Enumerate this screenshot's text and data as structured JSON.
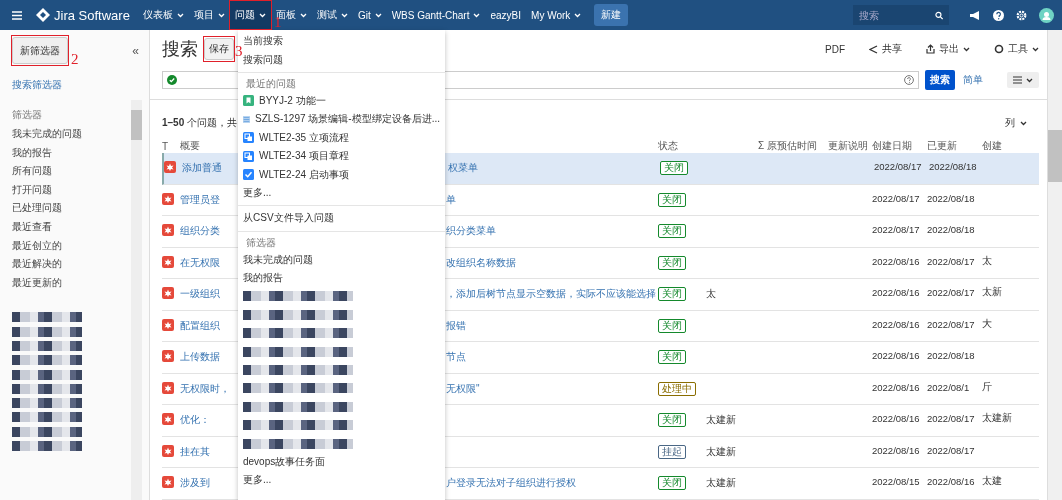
{
  "top_nav": {
    "product": "Jira Software",
    "items": [
      {
        "label": "仪表板",
        "dropdown": true,
        "selected": false
      },
      {
        "label": "项目",
        "dropdown": true,
        "selected": false
      },
      {
        "label": "问题",
        "dropdown": true,
        "selected": true
      },
      {
        "label": "面板",
        "dropdown": true,
        "selected": false
      },
      {
        "label": "测试",
        "dropdown": true,
        "selected": false
      },
      {
        "label": "Git",
        "dropdown": true,
        "selected": false
      },
      {
        "label": "WBS Gantt-Chart",
        "dropdown": true,
        "selected": false
      },
      {
        "label": "eazyBI",
        "dropdown": false,
        "selected": false
      },
      {
        "label": "My Work",
        "dropdown": true,
        "selected": false
      }
    ],
    "create_button": "新建",
    "search": {
      "placeholder": "搜索"
    }
  },
  "sidebar": {
    "new_filter_button": "新筛选器",
    "collapse": "«",
    "search_filters_link": "搜索筛选器",
    "sections": [
      {
        "heading": "筛选器",
        "items": [
          {
            "kind": "link",
            "label": "我未完成的问题"
          },
          {
            "kind": "link",
            "label": "我的报告"
          },
          {
            "kind": "link",
            "label": "所有问题"
          },
          {
            "kind": "link",
            "label": "打开问题"
          },
          {
            "kind": "link",
            "label": "已处理问题"
          },
          {
            "kind": "link",
            "label": "最近查看"
          },
          {
            "kind": "link",
            "label": "最近创立的"
          },
          {
            "kind": "link",
            "label": "最近解决的"
          },
          {
            "kind": "link",
            "label": "最近更新的"
          }
        ]
      },
      {
        "items": [
          {
            "kind": "redacted"
          },
          {
            "kind": "redacted"
          },
          {
            "kind": "redacted"
          },
          {
            "kind": "redacted"
          },
          {
            "kind": "redacted"
          },
          {
            "kind": "redacted"
          },
          {
            "kind": "redacted"
          },
          {
            "kind": "redacted"
          },
          {
            "kind": "redacted"
          },
          {
            "kind": "redacted"
          }
        ]
      }
    ]
  },
  "page": {
    "title": "搜索",
    "save_button": "保存",
    "actions": [
      {
        "kind": "pdf",
        "label": "PDF"
      },
      {
        "kind": "share",
        "label": "共享"
      },
      {
        "kind": "export",
        "label": "导出"
      },
      {
        "kind": "tools",
        "label": "工具"
      }
    ],
    "query": {
      "search_button": "搜索",
      "simple_link": "简单"
    },
    "result_count": "**1–50** 个问题，共",
    "columns_button": "列"
  },
  "table": {
    "columns": [
      "T",
      "概要",
      "状态",
      "",
      "Σ 原预估时间",
      "更新说明",
      "创建日期",
      "已更新",
      "创建"
    ],
    "rows": [
      {
        "selected": true,
        "summary_left": "添加普通",
        "summary_right": "权菜单",
        "status": {
          "label": "关闭",
          "color": "#14892c"
        },
        "assignee": "",
        "created": "2022/08/17",
        "updated": "2022/08/18",
        "creator": ""
      },
      {
        "selected": false,
        "summary_left": "管理员登",
        "summary_right": "单",
        "status": {
          "label": "关闭",
          "color": "#14892c"
        },
        "assignee": "",
        "created": "2022/08/17",
        "updated": "2022/08/18",
        "creator": ""
      },
      {
        "selected": false,
        "summary_left": "组织分类",
        "summary_right": "织分类菜单",
        "status": {
          "label": "关闭",
          "color": "#14892c"
        },
        "assignee": "",
        "created": "2022/08/17",
        "updated": "2022/08/18",
        "creator": ""
      },
      {
        "selected": false,
        "summary_left": "在无权限",
        "summary_right": "改组织名称数据",
        "status": {
          "label": "关闭",
          "color": "#14892c"
        },
        "assignee": "",
        "created": "2022/08/16",
        "updated": "2022/08/17",
        "creator": "太"
      },
      {
        "selected": false,
        "summary_left": "一级组织",
        "summary_right": "，添加后树节点显示空数据，实际不应该能选择",
        "status": {
          "label": "关闭",
          "color": "#14892c"
        },
        "assignee": "太",
        "created": "2022/08/16",
        "updated": "2022/08/17",
        "creator": "太新"
      },
      {
        "selected": false,
        "summary_left": "配置组织",
        "summary_right": "报错",
        "status": {
          "label": "关闭",
          "color": "#14892c"
        },
        "assignee": "",
        "created": "2022/08/16",
        "updated": "2022/08/17",
        "creator": "大"
      },
      {
        "selected": false,
        "summary_left": "上传数据",
        "summary_right": "节点",
        "status": {
          "label": "关闭",
          "color": "#14892c"
        },
        "assignee": "",
        "created": "2022/08/16",
        "updated": "2022/08/18",
        "creator": ""
      },
      {
        "selected": false,
        "summary_left": "无权限时，",
        "summary_right": "无权限\"",
        "status": {
          "label": "处理中",
          "color": "#8a6d00"
        },
        "assignee": "",
        "created": "2022/08/16",
        "updated": "2022/08/1",
        "creator": "斤"
      },
      {
        "selected": false,
        "summary_left": "优化：",
        "summary_right": "",
        "status": {
          "label": "关闭",
          "color": "#14892c"
        },
        "assignee": "太建新",
        "created": "2022/08/16",
        "updated": "2022/08/17",
        "creator": "太建新"
      },
      {
        "selected": false,
        "summary_left": "挂在其",
        "summary_right": "",
        "status": {
          "label": "挂起",
          "color": "#4a6785"
        },
        "assignee": "太建新",
        "created": "2022/08/16",
        "updated": "2022/08/17",
        "creator": ""
      },
      {
        "selected": false,
        "summary_left": "涉及到",
        "summary_right": "户登录无法对子组织进行授权",
        "status": {
          "label": "关闭",
          "color": "#14892c"
        },
        "assignee": "太建新",
        "created": "2022/08/15",
        "updated": "2022/08/16",
        "creator": "太建"
      }
    ]
  },
  "issues_menu": {
    "items": [
      {
        "kind": "link",
        "label": "当前搜索"
      },
      {
        "kind": "link",
        "label": "搜索问题"
      },
      {
        "kind": "divider"
      },
      {
        "kind": "heading",
        "label": "最近的问题"
      },
      {
        "kind": "story",
        "label": "BYYJ-2 功能一"
      },
      {
        "kind": "subtask",
        "label": "SZLS-1297 场景编辑-模型绑定设备后进..."
      },
      {
        "kind": "task",
        "label": "WLTE2-35 立项流程"
      },
      {
        "kind": "task",
        "label": "WLTE2-34 项目章程"
      },
      {
        "kind": "done",
        "label": "WLTE2-24 启动事项"
      },
      {
        "kind": "link",
        "label": "更多..."
      },
      {
        "kind": "divider"
      },
      {
        "kind": "link",
        "label": "从CSV文件导入问题"
      },
      {
        "kind": "divider"
      },
      {
        "kind": "heading",
        "label": "筛选器"
      },
      {
        "kind": "link",
        "label": "我未完成的问题"
      },
      {
        "kind": "link",
        "label": "我的报告"
      },
      {
        "kind": "redacted"
      },
      {
        "kind": "redacted"
      },
      {
        "kind": "redacted"
      },
      {
        "kind": "redacted"
      },
      {
        "kind": "redacted"
      },
      {
        "kind": "redacted"
      },
      {
        "kind": "redacted"
      },
      {
        "kind": "redacted"
      },
      {
        "kind": "redacted"
      },
      {
        "kind": "link",
        "label": "devops故事任务面"
      },
      {
        "kind": "link",
        "label": "更多..."
      }
    ]
  },
  "annotations": [
    {
      "label": "1"
    },
    {
      "label": "2"
    },
    {
      "label": "3"
    }
  ]
}
